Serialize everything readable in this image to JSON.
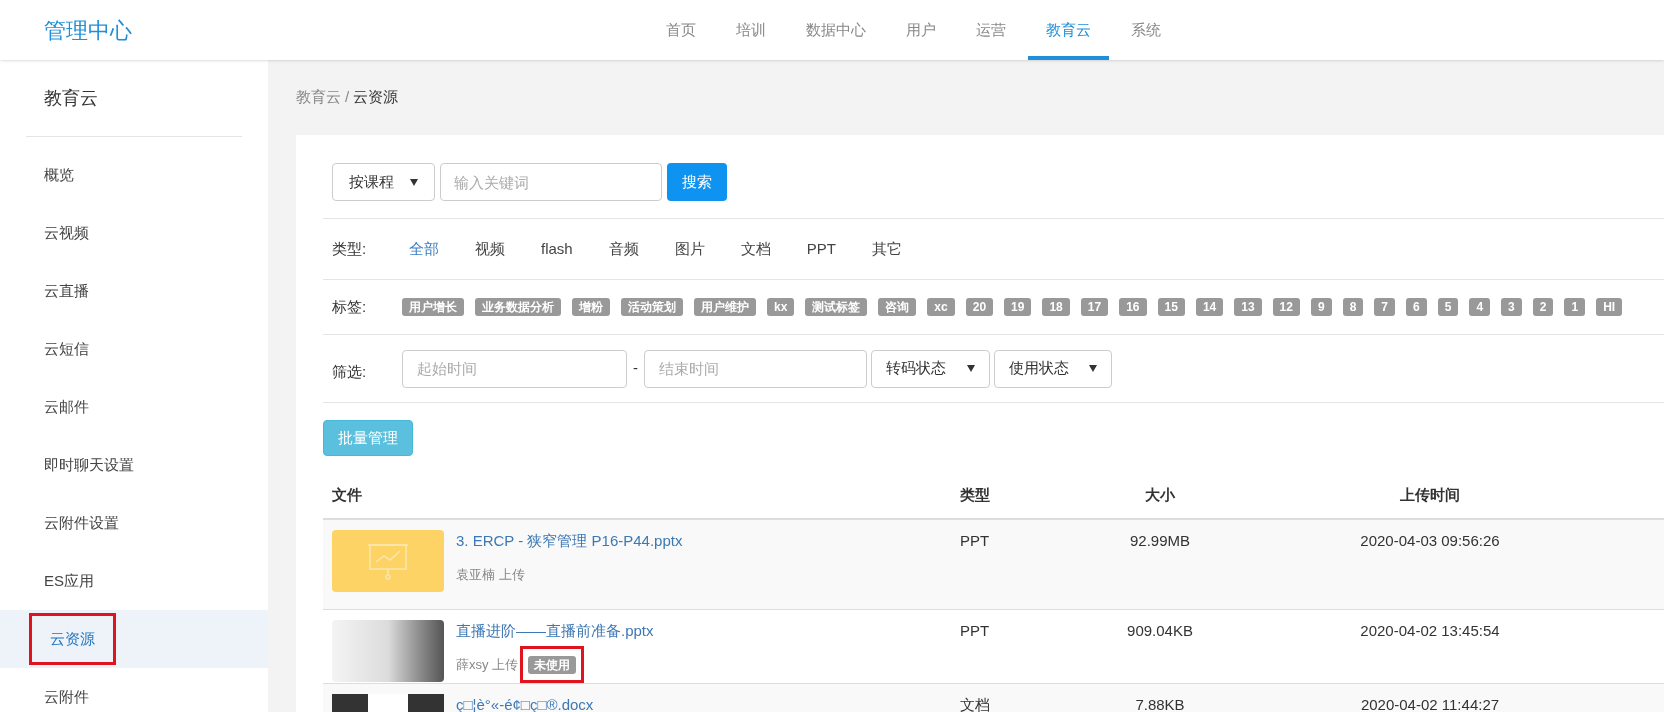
{
  "header": {
    "logo": "管理中心",
    "nav": [
      {
        "label": "首页",
        "selected": false
      },
      {
        "label": "培训",
        "selected": false
      },
      {
        "label": "数据中心",
        "selected": false
      },
      {
        "label": "用户",
        "selected": false
      },
      {
        "label": "运营",
        "selected": false
      },
      {
        "label": "教育云",
        "selected": true
      },
      {
        "label": "系统",
        "selected": false
      }
    ]
  },
  "sidebar": {
    "title": "教育云",
    "items": [
      {
        "label": "概览",
        "selected": false,
        "highlighted": false
      },
      {
        "label": "云视频",
        "selected": false,
        "highlighted": false
      },
      {
        "label": "云直播",
        "selected": false,
        "highlighted": false
      },
      {
        "label": "云短信",
        "selected": false,
        "highlighted": false
      },
      {
        "label": "云邮件",
        "selected": false,
        "highlighted": false
      },
      {
        "label": "即时聊天设置",
        "selected": false,
        "highlighted": false
      },
      {
        "label": "云附件设置",
        "selected": false,
        "highlighted": false
      },
      {
        "label": "ES应用",
        "selected": false,
        "highlighted": false
      },
      {
        "label": "云资源",
        "selected": true,
        "highlighted": true
      },
      {
        "label": "云附件",
        "selected": false,
        "highlighted": false
      }
    ]
  },
  "breadcrumb": {
    "parent": "教育云",
    "separator": "/",
    "current": "云资源"
  },
  "search": {
    "scope": "按课程",
    "placeholder": "输入关键词",
    "button": "搜索"
  },
  "type_filter": {
    "label": "类型:",
    "options": [
      {
        "label": "全部",
        "selected": true
      },
      {
        "label": "视频",
        "selected": false
      },
      {
        "label": "flash",
        "selected": false
      },
      {
        "label": "音频",
        "selected": false
      },
      {
        "label": "图片",
        "selected": false
      },
      {
        "label": "文档",
        "selected": false
      },
      {
        "label": "PPT",
        "selected": false
      },
      {
        "label": "其它",
        "selected": false
      }
    ]
  },
  "tags": {
    "label": "标签:",
    "items": [
      "用户增长",
      "业务数据分析",
      "增粉",
      "活动策划",
      "用户维护",
      "kx",
      "测试标签",
      "咨询",
      "xc",
      "20",
      "19",
      "18",
      "17",
      "16",
      "15",
      "14",
      "13",
      "12",
      "9",
      "8",
      "7",
      "6",
      "5",
      "4",
      "3",
      "2",
      "1",
      "HI"
    ]
  },
  "filters": {
    "label": "筛选:",
    "start_placeholder": "起始时间",
    "dash": "-",
    "end_placeholder": "结束时间",
    "transcode": "转码状态",
    "usage": "使用状态"
  },
  "batch_button": "批量管理",
  "table": {
    "columns": [
      "文件",
      "类型",
      "大小",
      "上传时间"
    ],
    "rows": [
      {
        "kind": "slides",
        "name": "3. ERCP - 狭窄管理 P16-P44.pptx",
        "uploader": "袁亚楠 上传",
        "badge": null,
        "type": "PPT",
        "size": "92.99MB",
        "time": "2020-04-03 09:56:26"
      },
      {
        "kind": "photo",
        "name": "直播进阶——直播前准备.pptx",
        "uploader": "薛xsy 上传",
        "badge": "未使用",
        "badge_highlighted": true,
        "type": "PPT",
        "size": "909.04KB",
        "time": "2020-04-02 13:45:54"
      },
      {
        "kind": "document",
        "name": "ç□¦è°«-é¢□ç□®.docx",
        "uploader": null,
        "badge": null,
        "type": "文档",
        "size": "7.88KB",
        "time": "2020-04-02 11:44:27"
      }
    ]
  }
}
